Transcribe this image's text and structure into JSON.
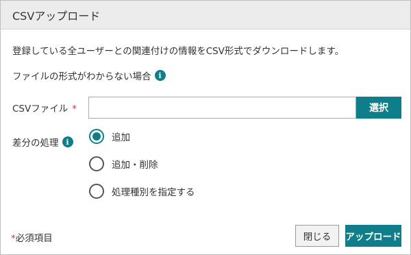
{
  "dialog": {
    "title": "CSVアップロード",
    "description": "登録している全ユーザーとの関連付けの情報をCSV形式でダウンロードします。",
    "help_text": "ファイルの形式がわからない場合",
    "info_icon_glyph": "i"
  },
  "csv_field": {
    "label": "CSVファイル",
    "required_mark": "*",
    "value": "",
    "placeholder": "",
    "select_label": "選択"
  },
  "diff": {
    "label": "差分の処理",
    "options": [
      {
        "label": "追加",
        "checked": true
      },
      {
        "label": "追加・削除",
        "checked": false
      },
      {
        "label": "処理種別を指定する",
        "checked": false
      }
    ]
  },
  "footer": {
    "required_mark": "*",
    "required_note": "必須項目",
    "close_label": "閉じる",
    "upload_label": "アップロード"
  },
  "colors": {
    "accent": "#0e7f8a",
    "required": "#dd3333",
    "header_bg": "#ececec"
  },
  "icons": {
    "info": "info-icon"
  }
}
